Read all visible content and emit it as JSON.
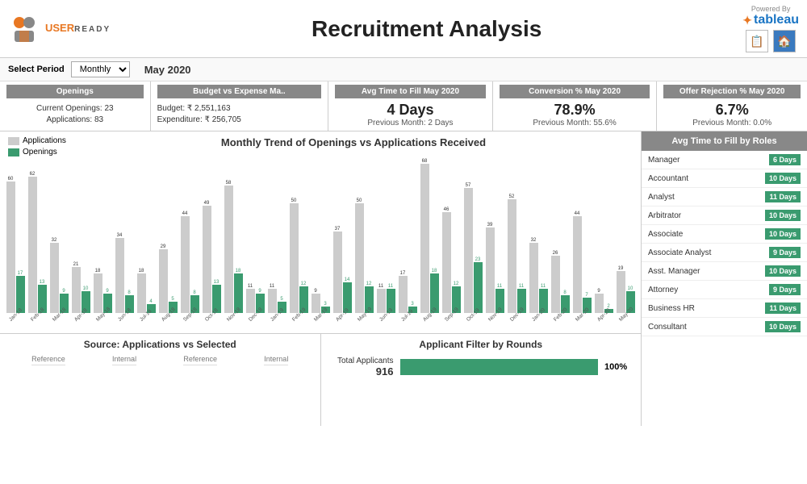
{
  "header": {
    "logo_text": "USER",
    "logo_sub": "READY",
    "title": "Recruitment Analysis",
    "powered_by": "Powered By",
    "tableau_label": "✦ tableau",
    "icons": [
      "📋",
      "🏠"
    ]
  },
  "filter": {
    "label": "Select Period",
    "value": "Monthly",
    "period": "May 2020"
  },
  "kpis": [
    {
      "title": "Openings",
      "lines": [
        "Current Openings: 23",
        "Applications: 83"
      ]
    },
    {
      "title": "Budget vs Expense Ma..",
      "lines": [
        "Budget: ₹ 2,551,163",
        "Expenditure: ₹ 256,705"
      ]
    },
    {
      "title": "Avg Time to Fill May 2020",
      "main": "4 Days",
      "sub": "Previous Month: 2 Days"
    },
    {
      "title": "Conversion % May 2020",
      "main": "78.9%",
      "sub": "Previous Month: 55.6%"
    },
    {
      "title": "Offer Rejection % May 2020",
      "main": "6.7%",
      "sub": "Previous Month: 0.0%"
    }
  ],
  "chart": {
    "title": "Monthly Trend of Openings vs Applications Received",
    "legend": [
      {
        "label": "Applications",
        "color": "#cccccc"
      },
      {
        "label": "Openings",
        "color": "#3a9b6f"
      }
    ],
    "bars": [
      {
        "month": "Jan-18",
        "apps": 60,
        "open": 17
      },
      {
        "month": "Feb-18",
        "apps": 62,
        "open": 13
      },
      {
        "month": "Mar-18",
        "apps": 32,
        "open": 9
      },
      {
        "month": "Apr-18",
        "apps": 21,
        "open": 10
      },
      {
        "month": "May-18",
        "apps": 18,
        "open": 9
      },
      {
        "month": "Jun-18",
        "apps": 34,
        "open": 8
      },
      {
        "month": "Jul-18",
        "apps": 18,
        "open": 4
      },
      {
        "month": "Aug-18",
        "apps": 29,
        "open": 5
      },
      {
        "month": "Sep-18",
        "apps": 44,
        "open": 8
      },
      {
        "month": "Oct-18",
        "apps": 49,
        "open": 13
      },
      {
        "month": "Nov-18",
        "apps": 58,
        "open": 18
      },
      {
        "month": "Dec-18",
        "apps": 11,
        "open": 9
      },
      {
        "month": "Jan-19",
        "apps": 11,
        "open": 5
      },
      {
        "month": "Feb-19",
        "apps": 50,
        "open": 12
      },
      {
        "month": "Mar-19",
        "apps": 9,
        "open": 3
      },
      {
        "month": "Apr-19",
        "apps": 37,
        "open": 14
      },
      {
        "month": "May-19",
        "apps": 50,
        "open": 12
      },
      {
        "month": "Jun-19",
        "apps": 11,
        "open": 11
      },
      {
        "month": "Jul-19",
        "apps": 17,
        "open": 3
      },
      {
        "month": "Aug-19",
        "apps": 68,
        "open": 18
      },
      {
        "month": "Sep-19",
        "apps": 46,
        "open": 12
      },
      {
        "month": "Oct-19",
        "apps": 57,
        "open": 23
      },
      {
        "month": "Nov-19",
        "apps": 39,
        "open": 11
      },
      {
        "month": "Dec-19",
        "apps": 52,
        "open": 11
      },
      {
        "month": "Jan-20",
        "apps": 32,
        "open": 11
      },
      {
        "month": "Feb-20",
        "apps": 26,
        "open": 8
      },
      {
        "month": "Mar-20",
        "apps": 44,
        "open": 7
      },
      {
        "month": "Apr-20",
        "apps": 9,
        "open": 2
      },
      {
        "month": "May-20",
        "apps": 19,
        "open": 10
      }
    ]
  },
  "roles_title": "Avg Time to Fill by Roles",
  "roles": [
    {
      "name": "Manager",
      "days": "6 Days"
    },
    {
      "name": "Accountant",
      "days": "10 Days"
    },
    {
      "name": "Analyst",
      "days": "11 Days"
    },
    {
      "name": "Arbitrator",
      "days": "10 Days"
    },
    {
      "name": "Associate",
      "days": "10 Days"
    },
    {
      "name": "Associate Analyst",
      "days": "9 Days"
    },
    {
      "name": "Asst. Manager",
      "days": "10 Days"
    },
    {
      "name": "Attorney",
      "days": "9 Days"
    },
    {
      "name": "Business HR",
      "days": "11 Days"
    },
    {
      "name": "Consultant",
      "days": "10 Days"
    }
  ],
  "bottom": {
    "left_title": "Source: Applications vs Selected",
    "right_title": "Applicant Filter by Rounds",
    "left_cols": [
      "Reference",
      "Internal",
      "Reference",
      "Internal"
    ],
    "applicants": {
      "label": "Total Applicants",
      "value": "916",
      "pct": "100%",
      "fill": 100
    }
  }
}
